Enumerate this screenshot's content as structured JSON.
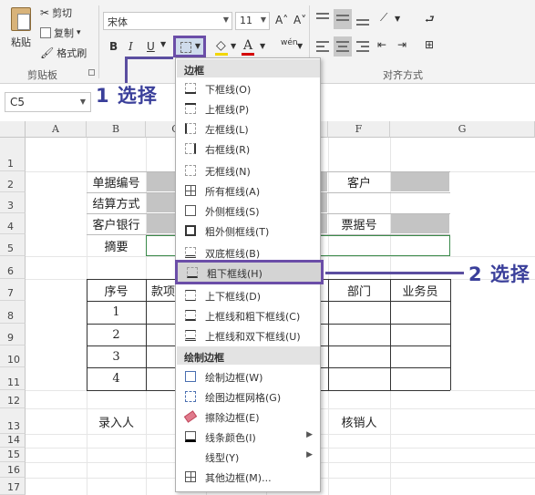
{
  "ribbon": {
    "clipboard": {
      "paste": "粘贴",
      "cut": "剪切",
      "copy": "复制",
      "copy_dropdown": "▾",
      "format_painter": "格式刷",
      "group_label": "剪贴板"
    },
    "font": {
      "font_name": "宋体",
      "font_size": "11",
      "grow": "A˄",
      "shrink": "A˅",
      "bold": "B",
      "italic": "I",
      "underline": "U",
      "pinyin": "wén"
    },
    "alignment": {
      "group_label": "对齐方式"
    }
  },
  "formula_bar": {
    "name_box": "C5"
  },
  "annotations": {
    "step1": "1 选择",
    "step2": "2 选择"
  },
  "sheet": {
    "columns": [
      "A",
      "B",
      "C",
      "D",
      "E",
      "F",
      "G"
    ],
    "rows": [
      "1",
      "2",
      "3",
      "4",
      "5",
      "6",
      "7",
      "8",
      "9",
      "10",
      "11",
      "12",
      "13",
      "14",
      "15",
      "16",
      "17"
    ],
    "cells": {
      "b2": "单据编号",
      "b3": "结算方式",
      "b4": "客户银行",
      "b5": "摘要",
      "f2": "客户",
      "f4": "票据号",
      "b7": "序号",
      "c7": "款项",
      "f7": "部门",
      "g7": "业务员",
      "b8": "1",
      "b9": "2",
      "b10": "3",
      "b11": "4",
      "b13": "录入人",
      "f13": "核销人"
    }
  },
  "menu": {
    "section_border": "边框",
    "items": [
      "下框线(O)",
      "上框线(P)",
      "左框线(L)",
      "右框线(R)",
      "无框线(N)",
      "所有框线(A)",
      "外侧框线(S)",
      "粗外侧框线(T)",
      "双底框线(B)",
      "粗下框线(H)",
      "上下框线(D)",
      "上框线和粗下框线(C)",
      "上框线和双下框线(U)"
    ],
    "section_draw": "绘制边框",
    "draw_items": [
      "绘制边框(W)",
      "绘图边框网格(G)",
      "擦除边框(E)",
      "线条颜色(I)",
      "线型(Y)",
      "其他边框(M)..."
    ],
    "highlighted": "粗下框线(H)"
  }
}
